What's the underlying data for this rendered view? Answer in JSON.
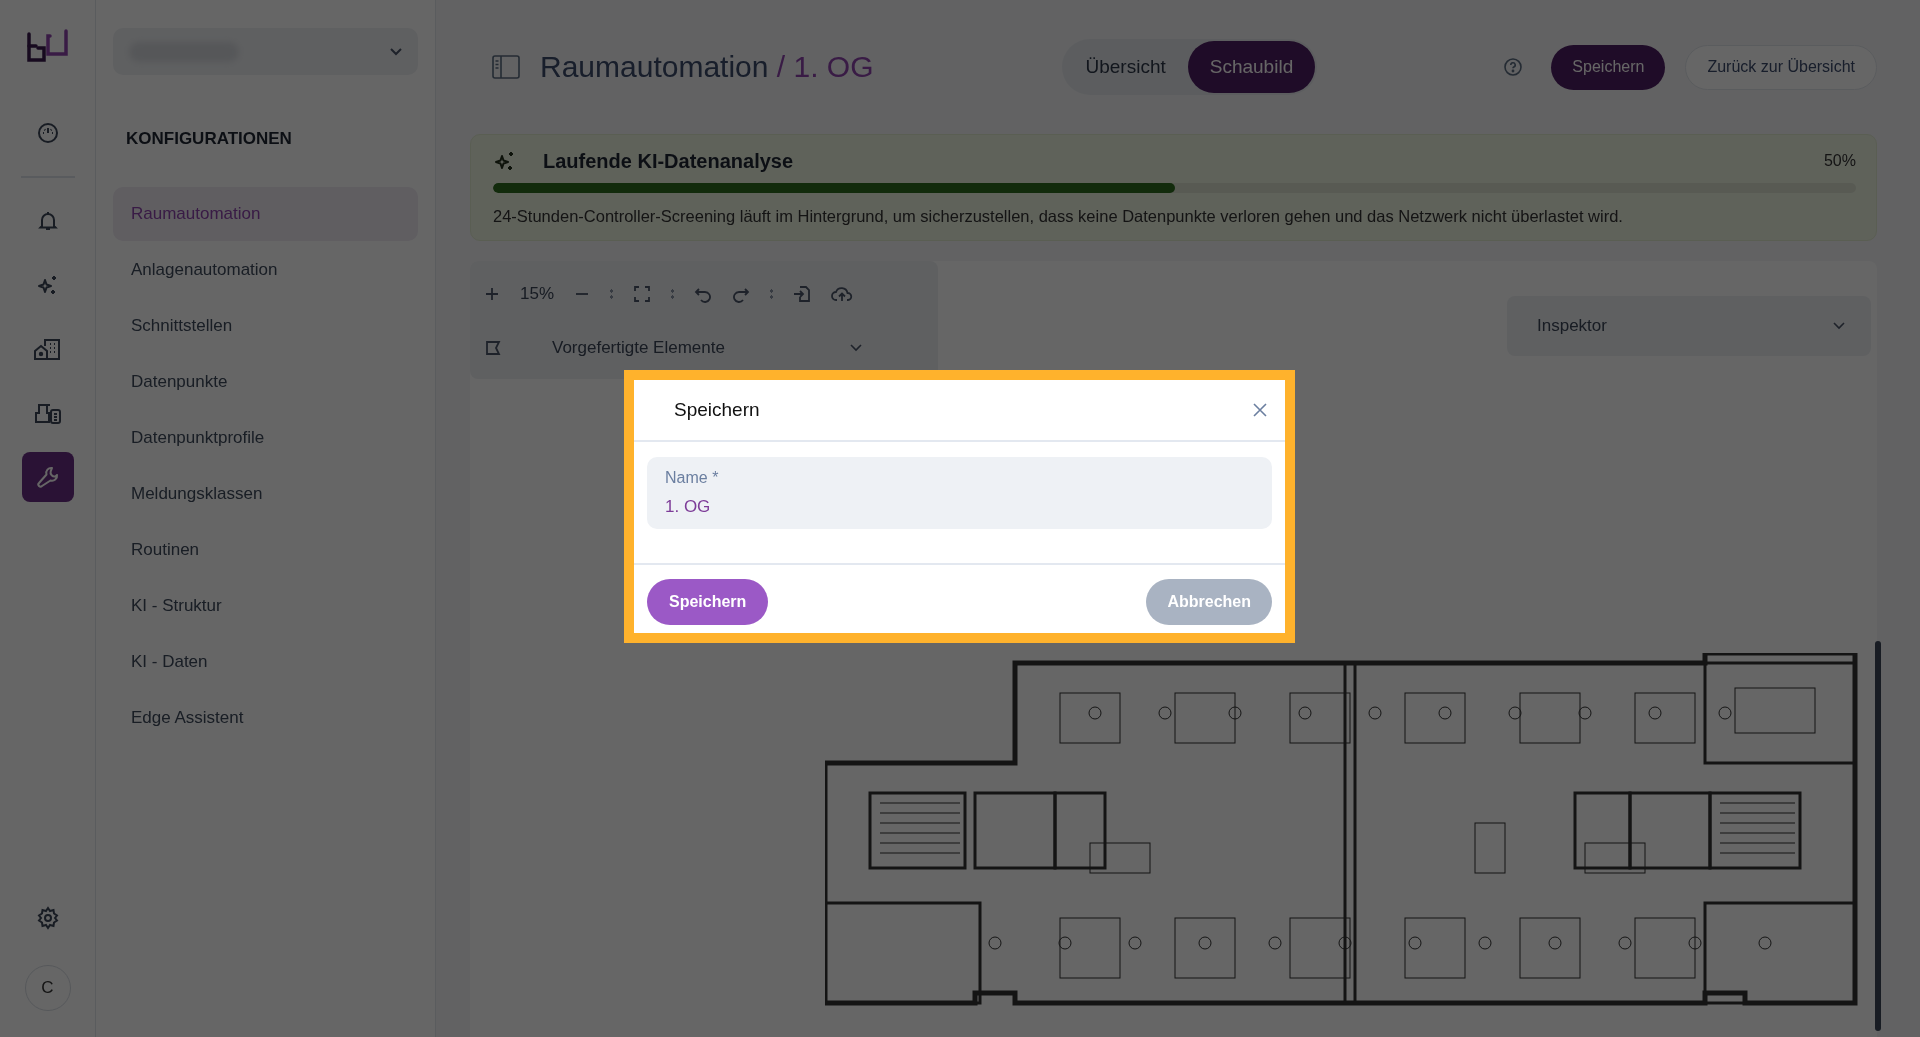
{
  "rail": {
    "items": [
      {
        "kind": "dashboard",
        "selected": false
      },
      {
        "kind": "notifications",
        "selected": false
      },
      {
        "kind": "ai",
        "selected": false
      },
      {
        "kind": "buildings",
        "selected": false
      },
      {
        "kind": "devices",
        "selected": false
      },
      {
        "kind": "tools",
        "selected": true
      }
    ],
    "avatar": "C"
  },
  "sidebar": {
    "heading": "KONFIGURATIONEN",
    "items": [
      {
        "label": "Raumautomation",
        "selected": true
      },
      {
        "label": "Anlagenautomation",
        "selected": false
      },
      {
        "label": "Schnittstellen",
        "selected": false
      },
      {
        "label": "Datenpunkte",
        "selected": false
      },
      {
        "label": "Datenpunktprofile",
        "selected": false
      },
      {
        "label": "Meldungsklassen",
        "selected": false
      },
      {
        "label": "Routinen",
        "selected": false
      },
      {
        "label": "KI - Struktur",
        "selected": false
      },
      {
        "label": "KI - Daten",
        "selected": false
      },
      {
        "label": "Edge Assistent",
        "selected": false
      }
    ]
  },
  "header": {
    "title": "Raumautomation",
    "subtitle": "/ 1. OG",
    "view_tabs": [
      {
        "label": "Übersicht",
        "selected": false
      },
      {
        "label": "Schaubild",
        "selected": true
      }
    ],
    "save": "Speichern",
    "back": "Zurück zur Übersicht"
  },
  "banner": {
    "title": "Laufende KI-Datenanalyse",
    "level": 0.5,
    "reading": "50%",
    "text": "24-Stunden-Controller-Screening läuft im Hintergrund, um sicherzustellen, dass keine Datenpunkte verloren gehen und das Netzwerk nicht überlastet wird."
  },
  "toolbar": {
    "zoom": "15%",
    "elements_label": "Vorgefertigte Elemente"
  },
  "inspector": {
    "label": "Inspektor"
  },
  "dialog": {
    "title": "Speichern",
    "field": {
      "label": "Name *",
      "value": "1. OG"
    },
    "confirm": "Speichern",
    "cancel": "Abbrechen"
  }
}
